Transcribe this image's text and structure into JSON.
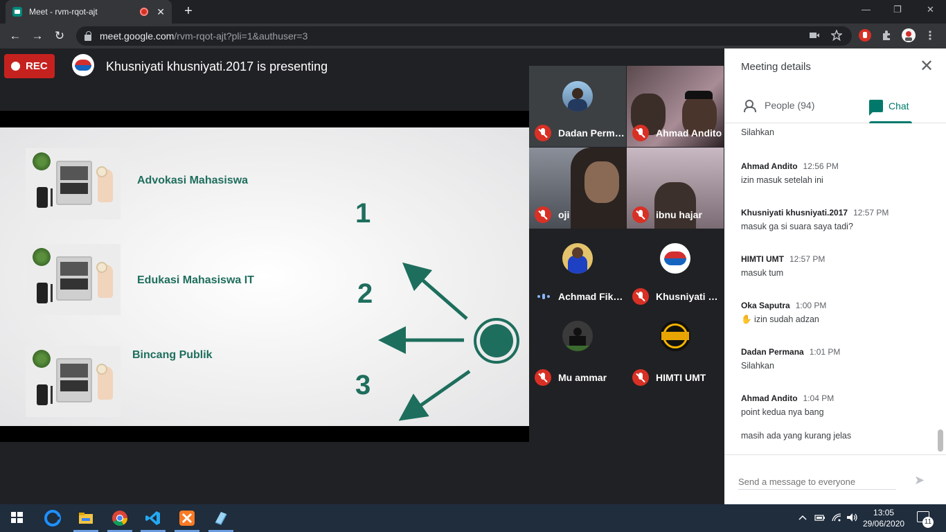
{
  "browser": {
    "tab_title": "Meet - rvm-rqot-ajt",
    "tab_close": "✕",
    "new_tab": "+",
    "back": "←",
    "forward": "→",
    "reload": "↻",
    "url_host": "meet.google.com",
    "url_path": "/rvm-rqot-ajt?pli=1&authuser=3",
    "minimize": "—",
    "restore": "❐",
    "close": "✕"
  },
  "meeting": {
    "rec_label": "REC",
    "presenting_text": "Khusniyati khusniyati.2017 is presenting"
  },
  "slide": {
    "items": [
      {
        "label": "Advokasi Mahasiswa",
        "number": "1"
      },
      {
        "label": "Edukasi Mahasiswa IT",
        "number": "2"
      },
      {
        "label": "Bincang Publik",
        "number": "3"
      }
    ],
    "accent": "#1e6e5d"
  },
  "participants": [
    {
      "name": "Dadan Perma...",
      "muted": true
    },
    {
      "name": "Ahmad Andito",
      "muted": true
    },
    {
      "name": "oji",
      "muted": true
    },
    {
      "name": "ibnu hajar",
      "muted": true
    },
    {
      "name": "Achmad Fikri ...",
      "muted": false
    },
    {
      "name": "Khusniyati kh...",
      "muted": true
    },
    {
      "name": "Mu ammar",
      "muted": true
    },
    {
      "name": "HIMTI UMT",
      "muted": true
    }
  ],
  "panel": {
    "title": "Meeting details",
    "close": "✕",
    "people_tab": "People (94)",
    "chat_tab": "Chat",
    "messages": [
      {
        "sender": "",
        "time": "",
        "text": "Silahkan"
      },
      {
        "sender": "Ahmad Andito",
        "time": "12:56 PM",
        "text": "izin masuk setelah ini"
      },
      {
        "sender": "Khusniyati khusniyati.2017",
        "time": "12:57 PM",
        "text": "masuk ga si suara saya tadi?"
      },
      {
        "sender": "HIMTI UMT",
        "time": "12:57 PM",
        "text": "masuk tum"
      },
      {
        "sender": "Oka Saputra",
        "time": "1:00 PM",
        "text": "✋ izin sudah adzan"
      },
      {
        "sender": "Dadan Permana",
        "time": "1:01 PM",
        "text": "Silahkan"
      },
      {
        "sender": "Ahmad Andito",
        "time": "1:04 PM",
        "text": "point kedua nya bang"
      },
      {
        "sender": "",
        "time": "",
        "text": "masih ada yang kurang jelas"
      }
    ],
    "compose_placeholder": "Send a message to everyone",
    "send_icon": "➤"
  },
  "taskbar": {
    "time": "13:05",
    "date": "29/06/2020",
    "notification_count": "11"
  },
  "colors": {
    "meet_red": "#d93025",
    "meet_green": "#00796b",
    "stage_bg": "#202124"
  }
}
